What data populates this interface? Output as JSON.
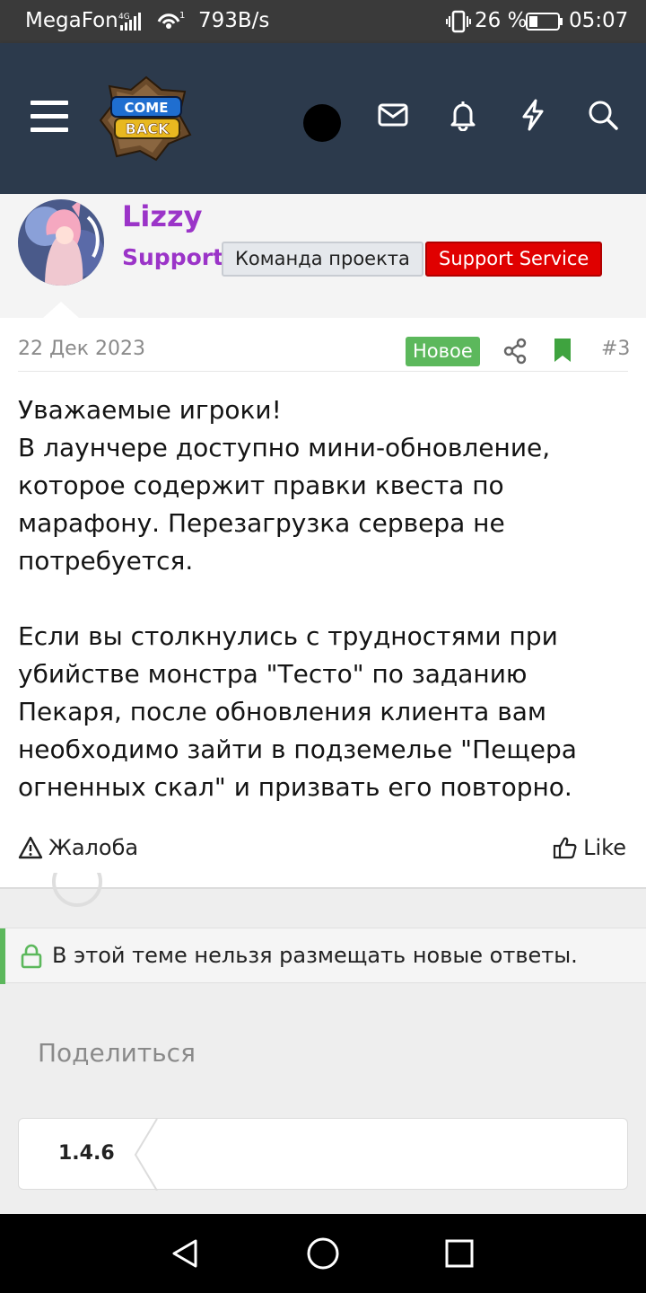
{
  "status_bar": {
    "carrier": "MegaFon",
    "network_type": "4G",
    "wifi_label": "1",
    "speed": "793B/s",
    "battery_percent": "26 %",
    "time": "05:07",
    "icons": [
      "signal-icon",
      "wifi-icon",
      "vibrate-icon",
      "battery-icon"
    ]
  },
  "header": {
    "logo_text": "COME BACK",
    "icons": [
      "menu-icon",
      "avatar-icon",
      "mail-icon",
      "bell-icon",
      "lightning-icon",
      "search-icon"
    ],
    "background": "#2c3a4c"
  },
  "author": {
    "name": "Lizzy",
    "role": "Support",
    "tags": [
      "Команда проекта",
      "Support Service"
    ],
    "name_color": "#9b34c8"
  },
  "post": {
    "date": "22 Дек 2023",
    "badge": "Новое",
    "number": "#3",
    "paragraphs": [
      "Уважаемые игроки!\nВ лаунчере доступно мини-обновление, которое содержит правки квеста по марафону. Перезагрузка сервера не потребуется.",
      "Если вы столкнулись с трудностями при убийстве монстра \"Тесто\" по заданию Пекаря, после обновления клиента вам необходимо зайти в подземелье \"Пещера огненных скал\" и призвать его повторно."
    ],
    "report_label": "Жалоба",
    "like_label": "Like",
    "badge_color": "#5cb85c"
  },
  "notice": {
    "locked_text": "В этой теме нельзя размещать новые ответы."
  },
  "share": {
    "title": "Поделиться"
  },
  "breadcrumb": {
    "version": "1.4.6"
  },
  "nav_bar": {
    "icons": [
      "back-icon",
      "home-icon",
      "recents-icon"
    ]
  }
}
